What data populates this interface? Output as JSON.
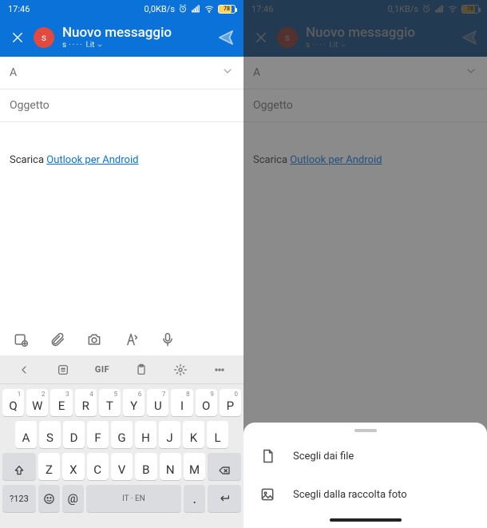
{
  "status": {
    "time": "17:46",
    "net_left": "0,0KB/s",
    "net_right": "0,1KB/s",
    "battery": "78"
  },
  "header": {
    "title": "Nuovo messaggio",
    "account_suffix": "l.it",
    "avatar_letter": "s"
  },
  "fields": {
    "to_label": "A",
    "subject_label": "Oggetto"
  },
  "body": {
    "prefix": "Scarica ",
    "link_text": "Outlook per Android"
  },
  "keyboard": {
    "row1": [
      {
        "k": "Q",
        "n": "1"
      },
      {
        "k": "W",
        "n": "2"
      },
      {
        "k": "E",
        "n": "3"
      },
      {
        "k": "R",
        "n": "4"
      },
      {
        "k": "T",
        "n": "5"
      },
      {
        "k": "Y",
        "n": "6"
      },
      {
        "k": "U",
        "n": "7"
      },
      {
        "k": "I",
        "n": "8"
      },
      {
        "k": "O",
        "n": "9"
      },
      {
        "k": "P",
        "n": "0"
      }
    ],
    "row2": [
      "A",
      "S",
      "D",
      "F",
      "G",
      "H",
      "J",
      "K",
      "L"
    ],
    "row3": [
      "Z",
      "X",
      "C",
      "V",
      "B",
      "N",
      "M"
    ],
    "sym": "?123",
    "space": "IT · EN",
    "gif": "GIF"
  },
  "sheet": {
    "item1": "Scegli dai file",
    "item2": "Scegli dalla raccolta foto"
  }
}
